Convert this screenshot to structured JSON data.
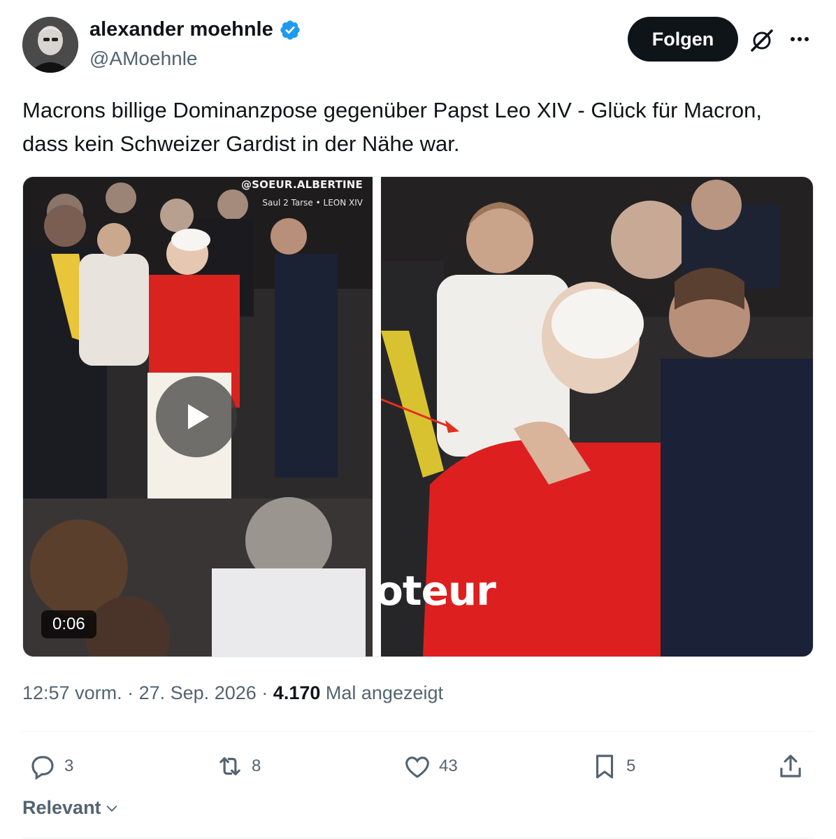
{
  "author": {
    "display_name": "alexander moehnle",
    "handle": "@AMoehnle",
    "verified": true,
    "avatar": "profile-photo"
  },
  "header": {
    "follow_label": "Folgen",
    "grok_icon": "grok-icon",
    "more_icon": "more-icon"
  },
  "tweet": {
    "text": "Macrons billige Dominanzpose gegenüber Papst Leo XIV - Glück für Macron, dass kein Schweizer Gardist in der Nähe war."
  },
  "media": {
    "video": {
      "watermark_handle": "@SOEUR.ALBERTINE",
      "watermark_caption": "Saul 2 Tarse • LEON XIV",
      "duration": "0:06"
    },
    "image": {
      "overlay_text": "oteur"
    }
  },
  "meta": {
    "time": "12:57 vorm.",
    "separator": "·",
    "date": "27. Sep. 2026",
    "views_count": "4.170",
    "views_label": "Mal angezeigt"
  },
  "actions": {
    "replies": "3",
    "reposts": "8",
    "likes": "43",
    "bookmarks": "5"
  },
  "sort": {
    "label": "Relevant"
  },
  "colors": {
    "text": "#0f1419",
    "secondary": "#536471",
    "verified": "#1d9bf0",
    "follow_bg": "#0f1419"
  }
}
